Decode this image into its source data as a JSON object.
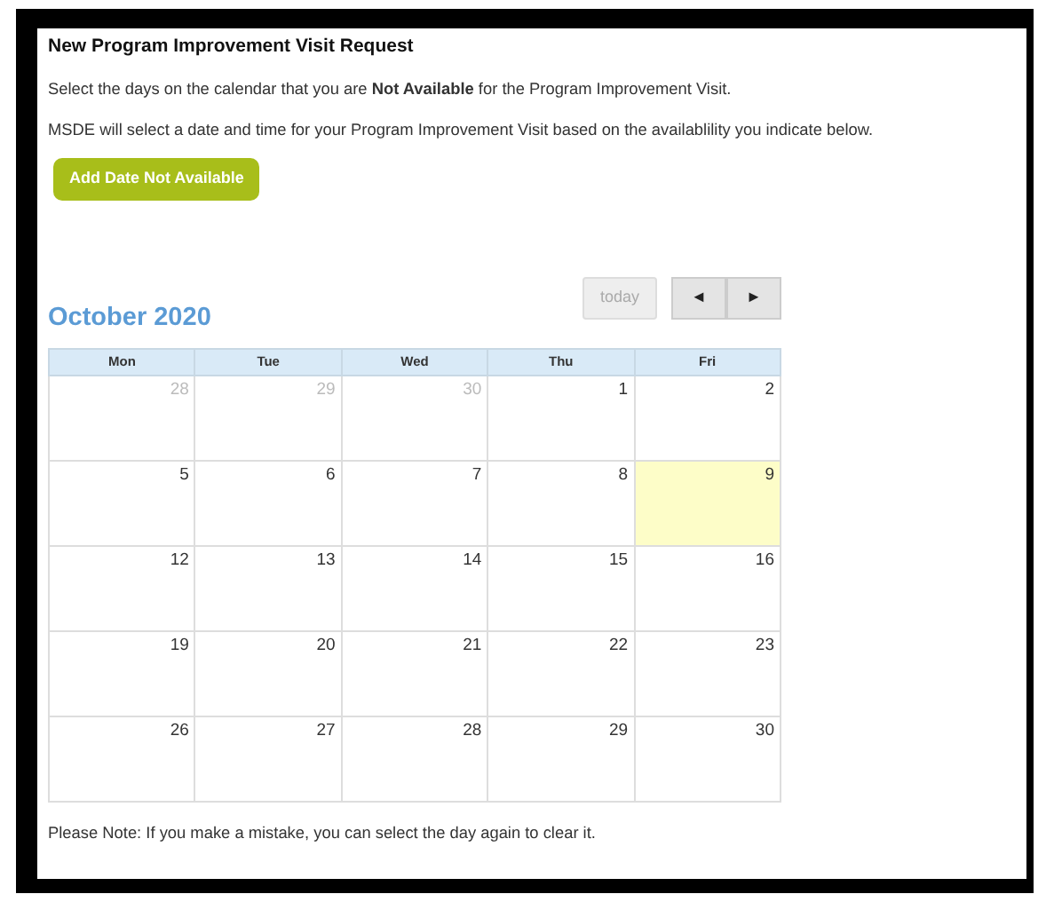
{
  "title": "New Program Improvement Visit Request",
  "instructions": [
    "Select the days on the calendar that you are **Not Available** for the Program Improvement Visit.",
    "MSDE will select a date and time for your Program Improvement Visit based on the availablility you indicate below."
  ],
  "add_button": {
    "label": "Add Date Not Available"
  },
  "calendar": {
    "title": "October 2020",
    "today_button": {
      "label": "today",
      "disabled": true
    },
    "prev_button": {
      "label": "◄"
    },
    "next_button": {
      "label": "►"
    },
    "weekdays": [
      "Mon",
      "Tue",
      "Wed",
      "Thu",
      "Fri"
    ],
    "weeks": [
      [
        {
          "day": "28",
          "other_month": true,
          "today": false
        },
        {
          "day": "29",
          "other_month": true,
          "today": false
        },
        {
          "day": "30",
          "other_month": true,
          "today": false
        },
        {
          "day": "1",
          "other_month": false,
          "today": false
        },
        {
          "day": "2",
          "other_month": false,
          "today": false
        }
      ],
      [
        {
          "day": "5",
          "other_month": false,
          "today": false
        },
        {
          "day": "6",
          "other_month": false,
          "today": false
        },
        {
          "day": "7",
          "other_month": false,
          "today": false
        },
        {
          "day": "8",
          "other_month": false,
          "today": false
        },
        {
          "day": "9",
          "other_month": false,
          "today": true
        }
      ],
      [
        {
          "day": "12",
          "other_month": false,
          "today": false
        },
        {
          "day": "13",
          "other_month": false,
          "today": false
        },
        {
          "day": "14",
          "other_month": false,
          "today": false
        },
        {
          "day": "15",
          "other_month": false,
          "today": false
        },
        {
          "day": "16",
          "other_month": false,
          "today": false
        }
      ],
      [
        {
          "day": "19",
          "other_month": false,
          "today": false
        },
        {
          "day": "20",
          "other_month": false,
          "today": false
        },
        {
          "day": "21",
          "other_month": false,
          "today": false
        },
        {
          "day": "22",
          "other_month": false,
          "today": false
        },
        {
          "day": "23",
          "other_month": false,
          "today": false
        }
      ],
      [
        {
          "day": "26",
          "other_month": false,
          "today": false
        },
        {
          "day": "27",
          "other_month": false,
          "today": false
        },
        {
          "day": "28",
          "other_month": false,
          "today": false
        },
        {
          "day": "29",
          "other_month": false,
          "today": false
        },
        {
          "day": "30",
          "other_month": false,
          "today": false
        }
      ]
    ]
  },
  "note": "Please Note: If you make a mistake, you can select the day again to clear it."
}
